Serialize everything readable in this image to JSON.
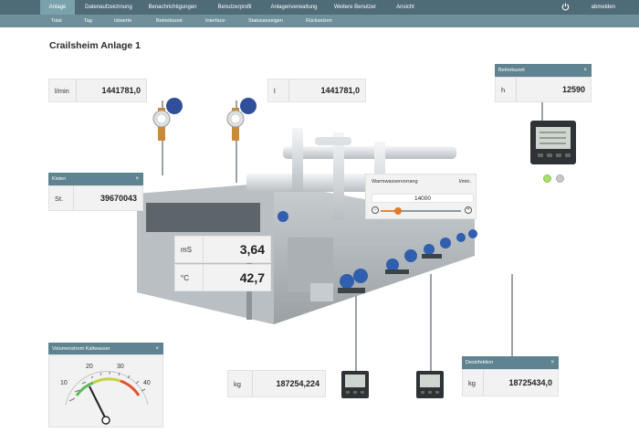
{
  "topnav": {
    "items": [
      "Anlage",
      "Datenaufzeichnung",
      "Benachrichtigungen",
      "Benutzerprofil",
      "Anlagenverwaltung",
      "Weitere Benutzer",
      "Ansicht"
    ],
    "logout": "abmelden"
  },
  "subnav": {
    "items": [
      "Total",
      "Tag",
      "Istwerte",
      "Betriebszeit",
      "Interface",
      "Statusanzeigen",
      "Rücksetzen"
    ]
  },
  "page": {
    "title": "Crailsheim Anlage 1"
  },
  "readouts": {
    "flow": {
      "unit": "l/min",
      "value": "1441781,0"
    },
    "liters": {
      "unit": "l",
      "value": "1441781,0"
    },
    "betriebszeit": {
      "title": "Betriebszeit",
      "unit": "h",
      "value": "12590"
    },
    "kisten": {
      "title": "Kisten",
      "unit": "St.",
      "value": "39670043"
    },
    "leitfaehigkeit": {
      "unit": "mS",
      "value": "3,64"
    },
    "temperatur": {
      "unit": "°C",
      "value": "42,7"
    },
    "kg": {
      "unit": "kg",
      "value": "187254,224"
    },
    "desinfektion": {
      "title": "Desinfektion",
      "unit": "kg",
      "value": "18725434,0"
    }
  },
  "slider": {
    "title": "Warmwasservorrang",
    "unit": "l/min.",
    "value": "14000",
    "minus": "−",
    "plus": "+",
    "level": 0.22
  },
  "gauge": {
    "title": "Volumenstrom Kaltwasser",
    "ticks": [
      "10",
      "20",
      "30",
      "40"
    ]
  },
  "close_glyph": "×",
  "colors": {
    "nav": "#4f6b78",
    "subnav": "#6f8f9b",
    "panel_head": "#5f8390",
    "led_green": "#a6e06a",
    "led_grey": "#c8c8c8"
  }
}
